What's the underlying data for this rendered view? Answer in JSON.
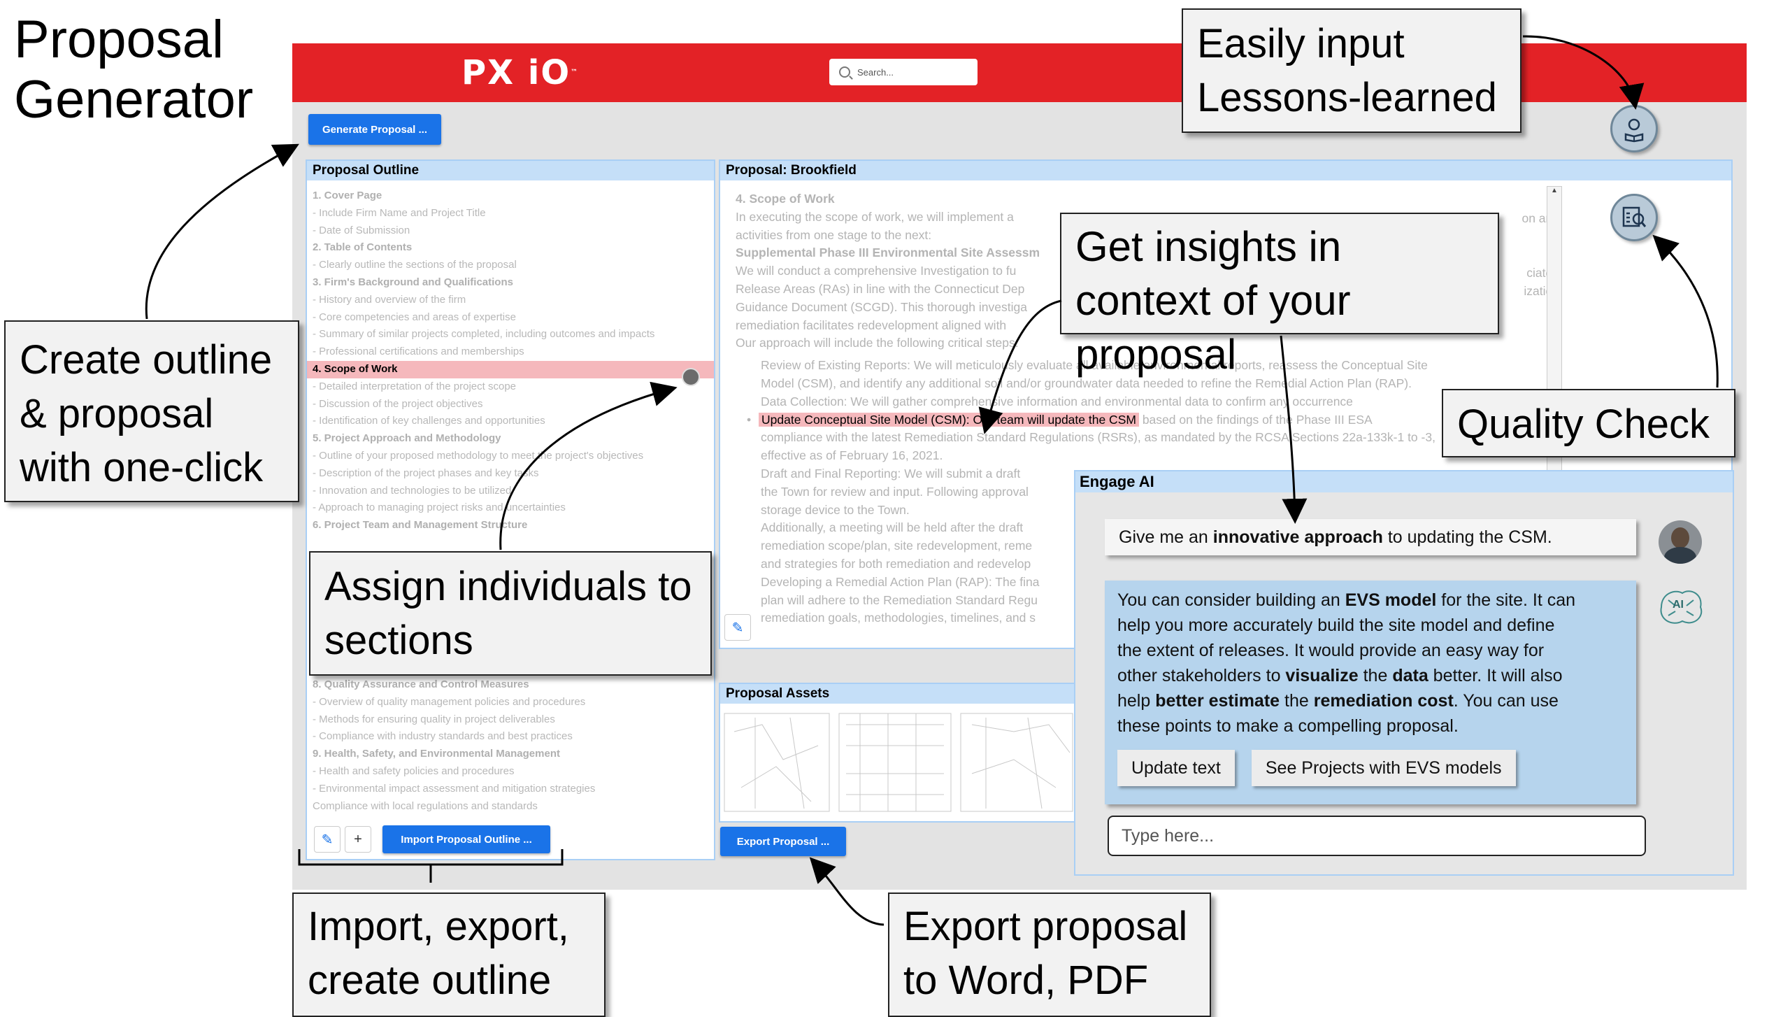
{
  "annotations": {
    "title": "Proposal Generator",
    "create_outline": "Create outline & proposal with one-click",
    "lessons": "Easily input Lessons-learned",
    "insights": "Get insights in context of your proposal",
    "quality": "Quality Check",
    "assign": "Assign individuals to sections",
    "import_export": "Import, export, create outline",
    "export_word": "Export proposal to Word, PDF"
  },
  "app": {
    "logo": "PX iO",
    "search_placeholder": "Search...",
    "generate_button": "Generate Proposal ..."
  },
  "outline": {
    "header": "Proposal Outline",
    "items": [
      {
        "text": "1. Cover Page",
        "style": "bold"
      },
      {
        "text": "- Include Firm Name and Project Title",
        "style": ""
      },
      {
        "text": "- Date of Submission",
        "style": ""
      },
      {
        "text": "2. Table of Contents",
        "style": "bold"
      },
      {
        "text": "- Clearly outline the sections of the proposal",
        "style": ""
      },
      {
        "text": "3. Firm's Background and Qualifications",
        "style": "bold"
      },
      {
        "text": "- History and overview of the firm",
        "style": ""
      },
      {
        "text": "- Core competencies and areas of expertise",
        "style": ""
      },
      {
        "text": "- Summary of similar projects completed, including outcomes and impacts",
        "style": ""
      },
      {
        "text": "- Professional certifications and memberships",
        "style": ""
      },
      {
        "text": "4. Scope of Work",
        "style": "hl"
      },
      {
        "text": "- Detailed interpretation of the project scope",
        "style": ""
      },
      {
        "text": "- Discussion of the project objectives",
        "style": ""
      },
      {
        "text": "- Identification of key challenges and opportunities",
        "style": ""
      },
      {
        "text": "5. Project Approach and Methodology",
        "style": "bold"
      },
      {
        "text": "- Outline of your proposed methodology to meet the project's objectives",
        "style": ""
      },
      {
        "text": "- Description of the project phases and key tasks",
        "style": ""
      },
      {
        "text": "- Innovation and technologies to be utilized",
        "style": ""
      },
      {
        "text": "- Approach to managing project risks and uncertainties",
        "style": ""
      },
      {
        "text": "6. Project Team and Management Structure",
        "style": "bold"
      }
    ],
    "items_lower": [
      {
        "text": "8. Quality Assurance and Control Measures",
        "style": "bold"
      },
      {
        "text": "- Overview of quality management policies and procedures",
        "style": ""
      },
      {
        "text": "- Methods for ensuring quality in project deliverables",
        "style": ""
      },
      {
        "text": "- Compliance with industry standards and best practices",
        "style": ""
      },
      {
        "text": "9. Health, Safety, and Environmental Management",
        "style": "bold"
      },
      {
        "text": "- Health and safety policies and procedures",
        "style": ""
      },
      {
        "text": "- Environmental impact assessment and mitigation strategies",
        "style": ""
      },
      {
        "text": "Compliance with local regulations and standards",
        "style": ""
      }
    ],
    "import_button": "Import Proposal Outline ...",
    "add_symbol": "+"
  },
  "proposal": {
    "header": "Proposal: Brookfield",
    "lines": [
      "4. Scope of Work",
      "In executing the scope of work, we will implement a",
      "activities from one stage to the next:",
      "Supplemental Phase III Environmental Site Assessm",
      "We will conduct a comprehensive Investigation to fu",
      "Release Areas (RAs) in line with the Connecticut Dep",
      "Guidance Document (SCGD). This thorough investiga",
      "remediation facilitates redevelopment aligned with",
      "Our approach will include the following critical steps:"
    ],
    "right_fragments": [
      "on and",
      "ciated",
      "ization"
    ],
    "bullets": [
      "Review of Existing Reports: We will meticulously evaluate all available environmental reports, reassess the Conceptual Site",
      "Model (CSM), and identify any additional soil and/or groundwater data needed to refine the Remedial Action Plan (RAP).",
      "Data Collection: We will gather comprehensive information and environmental data to confirm any occurrence"
    ],
    "highlight": "Update Conceptual Site Model (CSM): Our team will update the CSM",
    "highlight_rest": "based on the findings of the Phase III ESA",
    "lines_after": [
      "compliance with the latest Remediation Standard Regulations (RSRs), as mandated by the RCSA Sections 22a-133k-1 to -3,",
      "effective as of February 16, 2021.",
      "Draft and Final Reporting: We will submit a draft",
      "the Town for review and input. Following approval",
      "storage device to the Town.",
      "Additionally, a meeting will be held after the draft",
      "remediation scope/plan, site redevelopment, reme",
      "and strategies for both remediation and redevelop",
      "Developing a Remedial Action Plan (RAP): The fina",
      "plan will adhere to the Remediation Standard Regu",
      "remediation goals, methodologies, timelines, and s"
    ]
  },
  "assets": {
    "header": "Proposal Assets",
    "export_button": "Export Proposal ..."
  },
  "engage": {
    "header": "Engage AI",
    "user_prompt_pre": "Give me an ",
    "user_prompt_bold": "innovative approach",
    "user_prompt_post": " to updating the CSM.",
    "ai_line1_pre": "You can consider building an ",
    "ai_line1_bold": "EVS model",
    "ai_line1_post": " for the site. It can",
    "ai_line2": "help you more accurately build the site model and define",
    "ai_line3": "the extent of releases. It would provide an easy way for",
    "ai_line4_pre": "other stakeholders to ",
    "ai_line4_b1": "visualize",
    "ai_line4_mid": " the ",
    "ai_line4_b2": "data",
    "ai_line4_post": " better. It will also",
    "ai_line5_pre": "help ",
    "ai_line5_b1": "better estimate",
    "ai_line5_mid": " the ",
    "ai_line5_b2": "remediation cost",
    "ai_line5_post": ". You can use",
    "ai_line6": "these points to make a compelling proposal.",
    "update_button": "Update text",
    "projects_button": "See Projects with EVS models",
    "input_placeholder": "Type here...",
    "ai_badge": "AI"
  }
}
